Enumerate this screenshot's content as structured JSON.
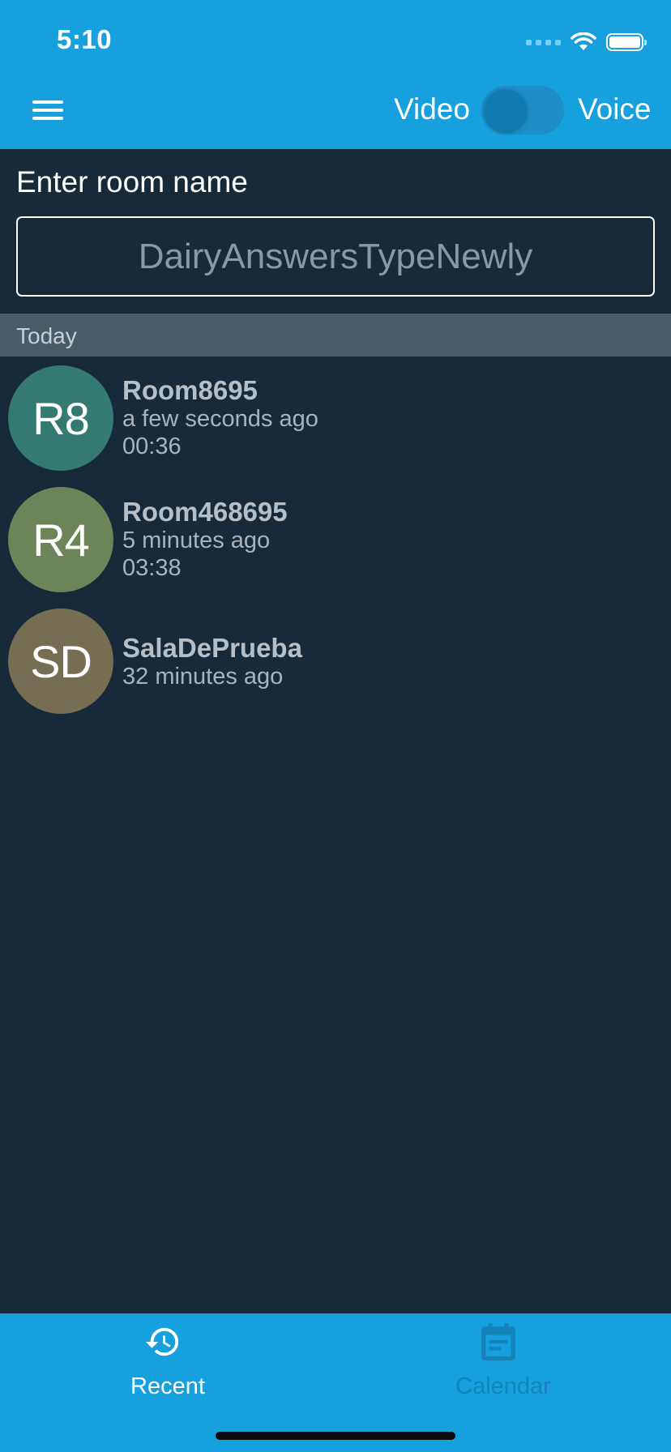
{
  "status_bar": {
    "time": "5:10"
  },
  "header": {
    "video_label": "Video",
    "voice_label": "Voice",
    "colors": {
      "background": "#17a0de"
    }
  },
  "room_entry": {
    "label": "Enter room name",
    "placeholder": "DairyAnswersTypeNewly"
  },
  "recent": {
    "section_title": "Today",
    "rooms": [
      {
        "initials": "R8",
        "name": "Room8695",
        "time_ago": "a few seconds ago",
        "duration": "00:36",
        "color": "#357a70"
      },
      {
        "initials": "R4",
        "name": "Room468695",
        "time_ago": "5 minutes ago",
        "duration": "03:38",
        "color": "#6c8457"
      },
      {
        "initials": "SD",
        "name": "SalaDePrueba",
        "time_ago": "32 minutes ago",
        "duration": "",
        "color": "#766e53"
      }
    ]
  },
  "tabbar": {
    "tabs": [
      {
        "label": "Recent",
        "icon": "history-icon",
        "active": true
      },
      {
        "label": "Calendar",
        "icon": "calendar-icon",
        "active": false
      }
    ],
    "colors": {
      "active": "#ffffff",
      "inactive": "#1484b8"
    }
  }
}
